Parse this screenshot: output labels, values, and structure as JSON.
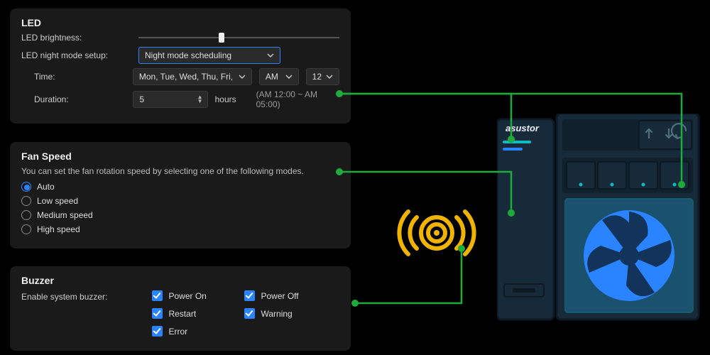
{
  "led": {
    "title": "LED",
    "brightness_label": "LED brightness:",
    "brightness_pct": 40,
    "night_label": "LED night mode setup:",
    "night_value": "Night mode scheduling",
    "time_label": "Time:",
    "days_value": "Mon, Tue, Wed, Thu, Fri, Sat, Sun",
    "ampm_value": "AM",
    "hour_value": "12",
    "duration_label": "Duration:",
    "duration_value": "5",
    "duration_unit": "hours",
    "duration_hint": "(AM 12:00 ~ AM 05:00)"
  },
  "fan": {
    "title": "Fan Speed",
    "desc": "You can set the fan rotation speed by selecting one of the following modes.",
    "options": [
      "Auto",
      "Low speed",
      "Medium speed",
      "High speed"
    ],
    "selected": "Auto"
  },
  "buzzer": {
    "title": "Buzzer",
    "enable_label": "Enable system buzzer:",
    "items": [
      {
        "label": "Power On",
        "checked": true
      },
      {
        "label": "Power Off",
        "checked": true
      },
      {
        "label": "Restart",
        "checked": true
      },
      {
        "label": "Warning",
        "checked": true
      },
      {
        "label": "Error",
        "checked": true
      }
    ]
  },
  "device": {
    "brand": "asustor"
  },
  "colors": {
    "accent": "#2a83ff",
    "wire": "#1faa3c",
    "buzzer": "#f0b400",
    "fan": "#2a83ff",
    "teal": "#17b8c4"
  }
}
